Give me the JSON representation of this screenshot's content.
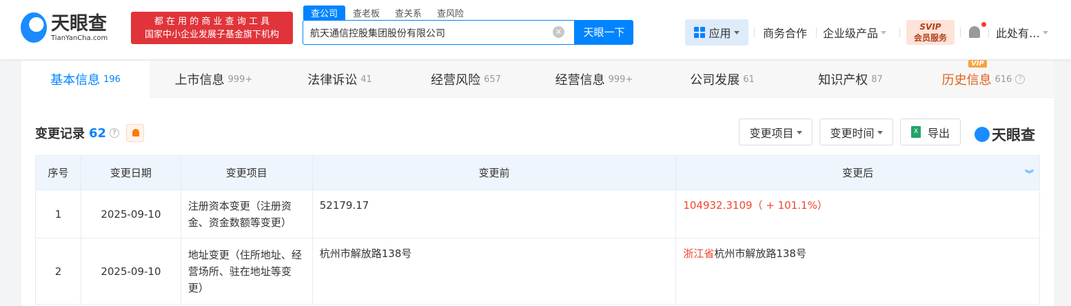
{
  "header": {
    "logo_cn": "天眼查",
    "logo_en": "TianYanCha.com",
    "slogan_line1": "都 在 用 的 商 业 查 询 工 具",
    "slogan_line2": "国家中小企业发展子基金旗下机构",
    "search_tabs": [
      "查公司",
      "查老板",
      "查关系",
      "查风险"
    ],
    "search_value": "航天通信控股集团股份有限公司",
    "search_button": "天眼一下",
    "nav": {
      "apps": "应用",
      "business": "商务合作",
      "enterprise": "企业级产品",
      "svip_line1": "SVIP",
      "svip_line2": "会员服务",
      "user": "此处有…"
    }
  },
  "tabs": [
    {
      "label": "基本信息",
      "count": "196"
    },
    {
      "label": "上市信息",
      "count": "999+"
    },
    {
      "label": "法律诉讼",
      "count": "41"
    },
    {
      "label": "经营风险",
      "count": "657"
    },
    {
      "label": "经营信息",
      "count": "999+"
    },
    {
      "label": "公司发展",
      "count": "61"
    },
    {
      "label": "知识产权",
      "count": "87"
    },
    {
      "label": "历史信息",
      "count": "616",
      "badge": "VIP"
    }
  ],
  "section": {
    "title": "变更记录",
    "count": "62",
    "filter_item": "变更项目",
    "filter_time": "变更时间",
    "export": "导出",
    "brand": "天眼查"
  },
  "table": {
    "headers": [
      "序号",
      "变更日期",
      "变更项目",
      "变更前",
      "变更后"
    ],
    "rows": [
      {
        "no": "1",
        "date": "2025-09-10",
        "item": "注册资本变更（注册资金、资金数额等变更）",
        "before": "52179.17",
        "after_highlight": "104932.3109（ + 101.1%）",
        "after_rest": ""
      },
      {
        "no": "2",
        "date": "2025-09-10",
        "item": "地址变更（住所地址、经营场所、驻在地址等变更）",
        "before": "杭州市解放路138号",
        "after_highlight": "浙江省",
        "after_rest": "杭州市解放路138号"
      }
    ]
  },
  "colors": {
    "accent": "#0084ff",
    "red": "#f0462f",
    "vip": "#e0601a"
  }
}
